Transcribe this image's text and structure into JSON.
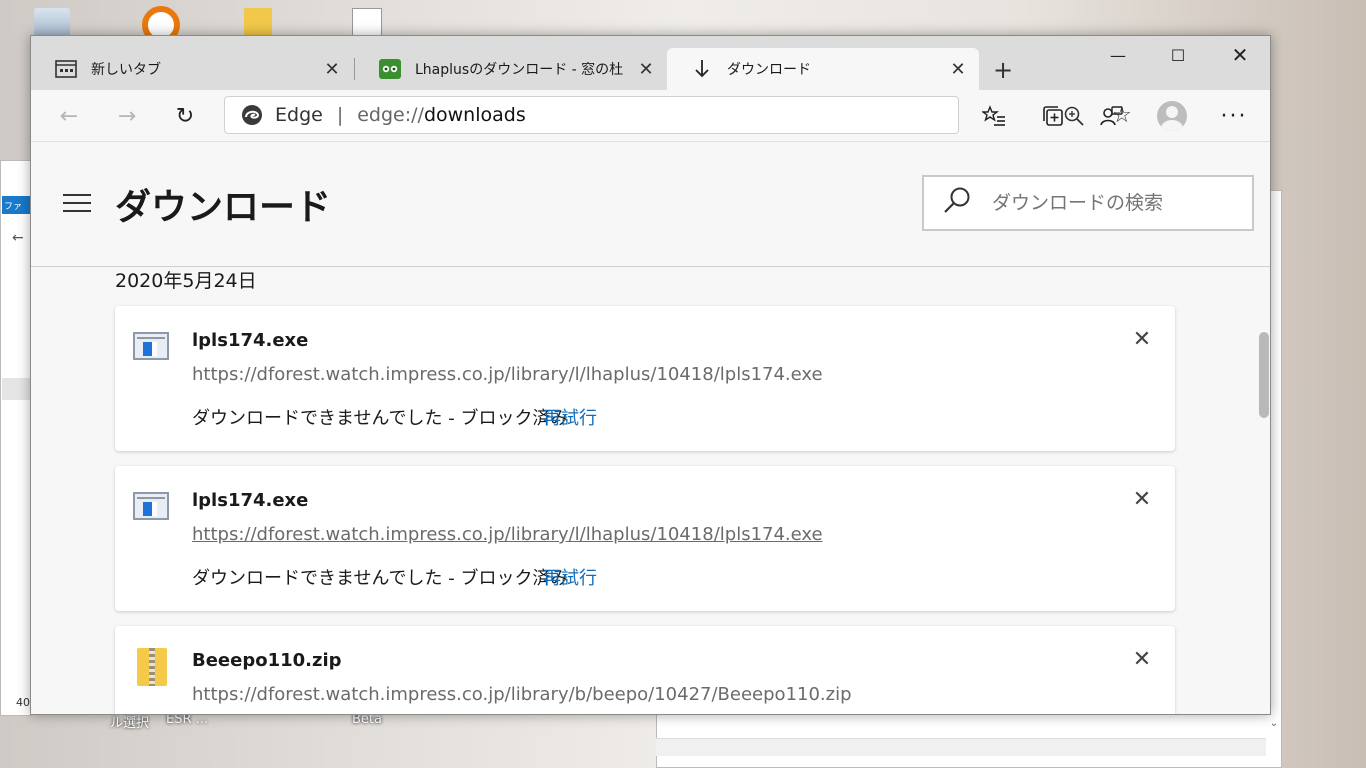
{
  "desktop": {
    "bottom_labels": [
      "ル選択",
      "ESR ...",
      "Beta"
    ],
    "left_window": {
      "tab_label": "ファ",
      "number": "40"
    }
  },
  "browser": {
    "tabs": [
      {
        "title": "新しいタブ",
        "icon": "new-tab-page-icon"
      },
      {
        "title": "Lhaplusのダウンロード - 窓の杜",
        "icon": "madonomori-icon"
      },
      {
        "title": "ダウンロード",
        "icon": "download-arrow-icon",
        "active": true
      }
    ],
    "tab_close_glyph": "✕",
    "new_tab_glyph": "+",
    "window_controls": {
      "minimize": "—",
      "maximize": "☐",
      "close": "✕"
    },
    "toolbar": {
      "back": "←",
      "forward": "→",
      "refresh": "↻",
      "favorites": "☆",
      "more": "···"
    },
    "address": {
      "brand": "Edge",
      "divider": "|",
      "url_prefix": "edge://",
      "url_main": "downloads"
    }
  },
  "page": {
    "title": "ダウンロード",
    "search_placeholder": "ダウンロードの検索",
    "date_heading": "2020年5月24日",
    "downloads": [
      {
        "name": "lpls174.exe",
        "url": "https://dforest.watch.impress.co.jp/library/l/lhaplus/10418/lpls174.exe",
        "status": "ダウンロードできませんでした - ブロック済み",
        "action": "再試行",
        "type": "exe"
      },
      {
        "name": "lpls174.exe",
        "url": "https://dforest.watch.impress.co.jp/library/l/lhaplus/10418/lpls174.exe",
        "status": "ダウンロードできませんでした - ブロック済み",
        "action": "再試行",
        "type": "exe"
      },
      {
        "name": "Beeepo110.zip",
        "url": "https://dforest.watch.impress.co.jp/library/b/beepo/10427/Beeepo110.zip",
        "type": "zip"
      }
    ],
    "remove_glyph": "✕"
  },
  "colors": {
    "link_blue": "#0f6cbd",
    "tab_strip": "#dcdcdc",
    "page_bg": "#f7f7f7"
  }
}
